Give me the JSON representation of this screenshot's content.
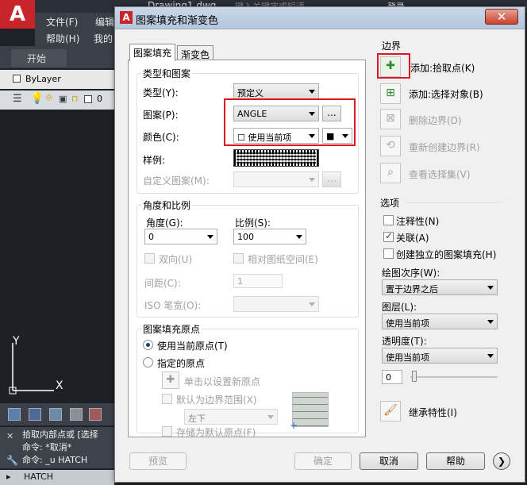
{
  "app": {
    "logo": "A",
    "top_title": "Drawing1.dwg",
    "search_placeholder": "键入关键字或短语",
    "login": "登录",
    "menu": [
      "文件(F)",
      "编辑",
      "帮助(H)",
      "我的"
    ],
    "doc_tab": "开始",
    "layer_value": "ByLayer",
    "layer_num": "0",
    "axis_y": "Y",
    "axis_x": "X",
    "command_lines": [
      "拾取内部点或 [选择",
      "命令: *取消*",
      "命令: _u HATCH"
    ],
    "command_input": "HATCH"
  },
  "dialog": {
    "title": "图案填充和渐变色",
    "close_label": "✕",
    "tabs": [
      "图案填充",
      "渐变色"
    ],
    "type_group": {
      "title": "类型和图案",
      "type_label": "类型(Y):",
      "type_value": "预定义",
      "pattern_label": "图案(P):",
      "pattern_value": "ANGLE",
      "color_label": "颜色(C):",
      "color_value": "☐ 使用当前项",
      "bg_color_value": "■",
      "swatch_label": "样例:",
      "custom_label": "自定义图案(M):",
      "browse_label": "..."
    },
    "angle_group": {
      "title": "角度和比例",
      "angle_label": "角度(G):",
      "angle_value": "0",
      "scale_label": "比例(S):",
      "scale_value": "100",
      "double_label": "双向(U)",
      "relative_label": "相对图纸空间(E)",
      "spacing_label": "间距(C):",
      "spacing_value": "1",
      "iso_label": "ISO 笔宽(O):"
    },
    "origin_group": {
      "title": "图案填充原点",
      "use_current": "使用当前原点(T)",
      "specified": "指定的原点",
      "click_set": "单击以设置新原点",
      "default_extent": "默认为边界范围(X)",
      "position_value": "左下",
      "store_default": "存储为默认原点(F)"
    },
    "boundary": {
      "title": "边界",
      "add_pick": "添加:拾取点(K)",
      "add_select": "添加:选择对象(B)",
      "remove": "删除边界(D)",
      "recreate": "重新创建边界(R)",
      "view_select": "查看选择集(V)"
    },
    "options": {
      "title": "选项",
      "annotative": "注释性(N)",
      "associative": "关联(A)",
      "separate": "创建独立的图案填充(H)",
      "draw_order_label": "绘图次序(W):",
      "draw_order_value": "置于边界之后",
      "layer_label": "图层(L):",
      "layer_value": "使用当前项",
      "transparency_label": "透明度(T):",
      "transparency_value": "使用当前项",
      "transparency_num": "0"
    },
    "inherit": "继承特性(I)",
    "buttons": {
      "preview": "预览",
      "ok": "确定",
      "cancel": "取消",
      "help": "帮助"
    },
    "colors": {
      "highlight": "#d8191f",
      "brand": "#c8242a"
    }
  }
}
